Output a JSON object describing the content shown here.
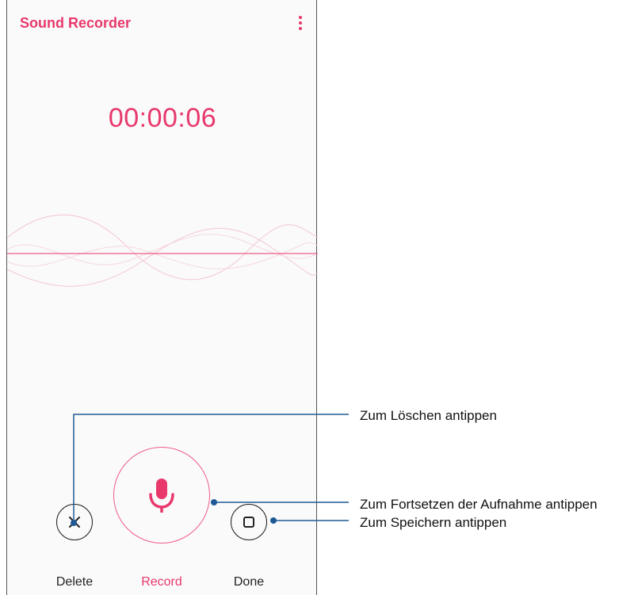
{
  "app": {
    "title": "Sound Recorder",
    "menu_icon": "more-vertical-icon"
  },
  "recorder": {
    "timer": "00:00:06"
  },
  "controls": {
    "delete_label": "Delete",
    "record_label": "Record",
    "done_label": "Done"
  },
  "callouts": {
    "delete": "Zum Löschen antippen",
    "record": "Zum Fortsetzen der Aufnahme antippen",
    "done": "Zum Speichern antippen"
  },
  "colors": {
    "accent": "#e8386c",
    "callout_line": "#1f5a96"
  }
}
